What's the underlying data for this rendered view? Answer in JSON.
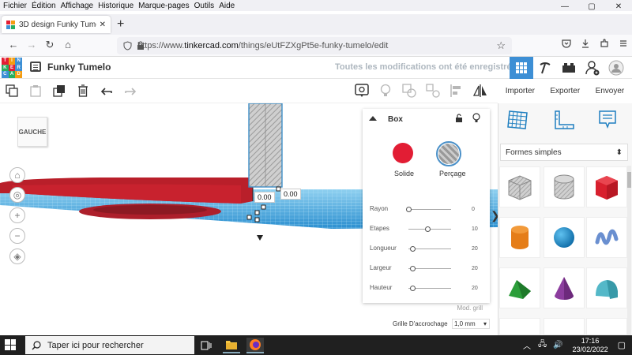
{
  "browser": {
    "menu": [
      "Fichier",
      "Édition",
      "Affichage",
      "Historique",
      "Marque-pages",
      "Outils",
      "Aide"
    ],
    "menu_accel": [
      "F",
      "É",
      "A",
      "H",
      "M",
      "O",
      "A"
    ],
    "window_controls": [
      "—",
      "▢",
      "✕"
    ],
    "tab_title": "3D design Funky Tumelo | Tinke",
    "tab_close": "✕",
    "new_tab": "+",
    "nav": {
      "back": "←",
      "forward": "→",
      "reload": "↻",
      "home": "⌂"
    },
    "url_prefix": "https://www.",
    "url_domain": "tinkercad.com",
    "url_path": "/things/eUtFZXgPt5e-funky-tumelo/edit",
    "bookmark_star": "☆",
    "right_icons": [
      "pocket-icon",
      "download-icon",
      "extensions-icon",
      "menu-icon"
    ]
  },
  "header": {
    "logo_letters": [
      "TIN",
      "KER",
      "CAD"
    ],
    "logo_colors": [
      "#e21d34",
      "#f39c12",
      "#3d8fd5",
      "#27ae60"
    ],
    "design_name": "Funky Tumelo",
    "saved_status": "Toutes les modifications ont été enregistrées"
  },
  "toolbar": {
    "actions": [
      "Importer",
      "Exporter",
      "Envoyer"
    ]
  },
  "viewport": {
    "viewcube_label": "GAUCHE",
    "dim_x": "0.00",
    "dim_y": "0.00"
  },
  "inspector": {
    "title": "Box",
    "solid_label": "Solide",
    "hole_label": "Perçage",
    "solid_color": "#e21d34",
    "props": [
      {
        "label": "Rayon",
        "value": "0",
        "level": 0.0
      },
      {
        "label": "Etapes",
        "value": "10",
        "level": 0.45
      },
      {
        "label": "Longueur",
        "value": "20",
        "level": 0.1
      },
      {
        "label": "Largeur",
        "value": "20",
        "level": 0.1
      },
      {
        "label": "Hauteur",
        "value": "20",
        "level": 0.1
      }
    ],
    "mod_grid": "Mod. grill",
    "snap_label": "Grille D'accrochage",
    "snap_value": "1,0 mm",
    "snap_arrow": "▾"
  },
  "shapes": {
    "category": "Formes simples",
    "category_arrow": "⬍",
    "items": [
      "box-hole",
      "cylinder-hole",
      "box",
      "cylinder",
      "sphere",
      "scribble",
      "roof",
      "cone",
      "round-roof"
    ]
  },
  "taskbar": {
    "search_placeholder": "Taper ici pour rechercher",
    "time": "17:16",
    "date": "23/02/2022"
  }
}
